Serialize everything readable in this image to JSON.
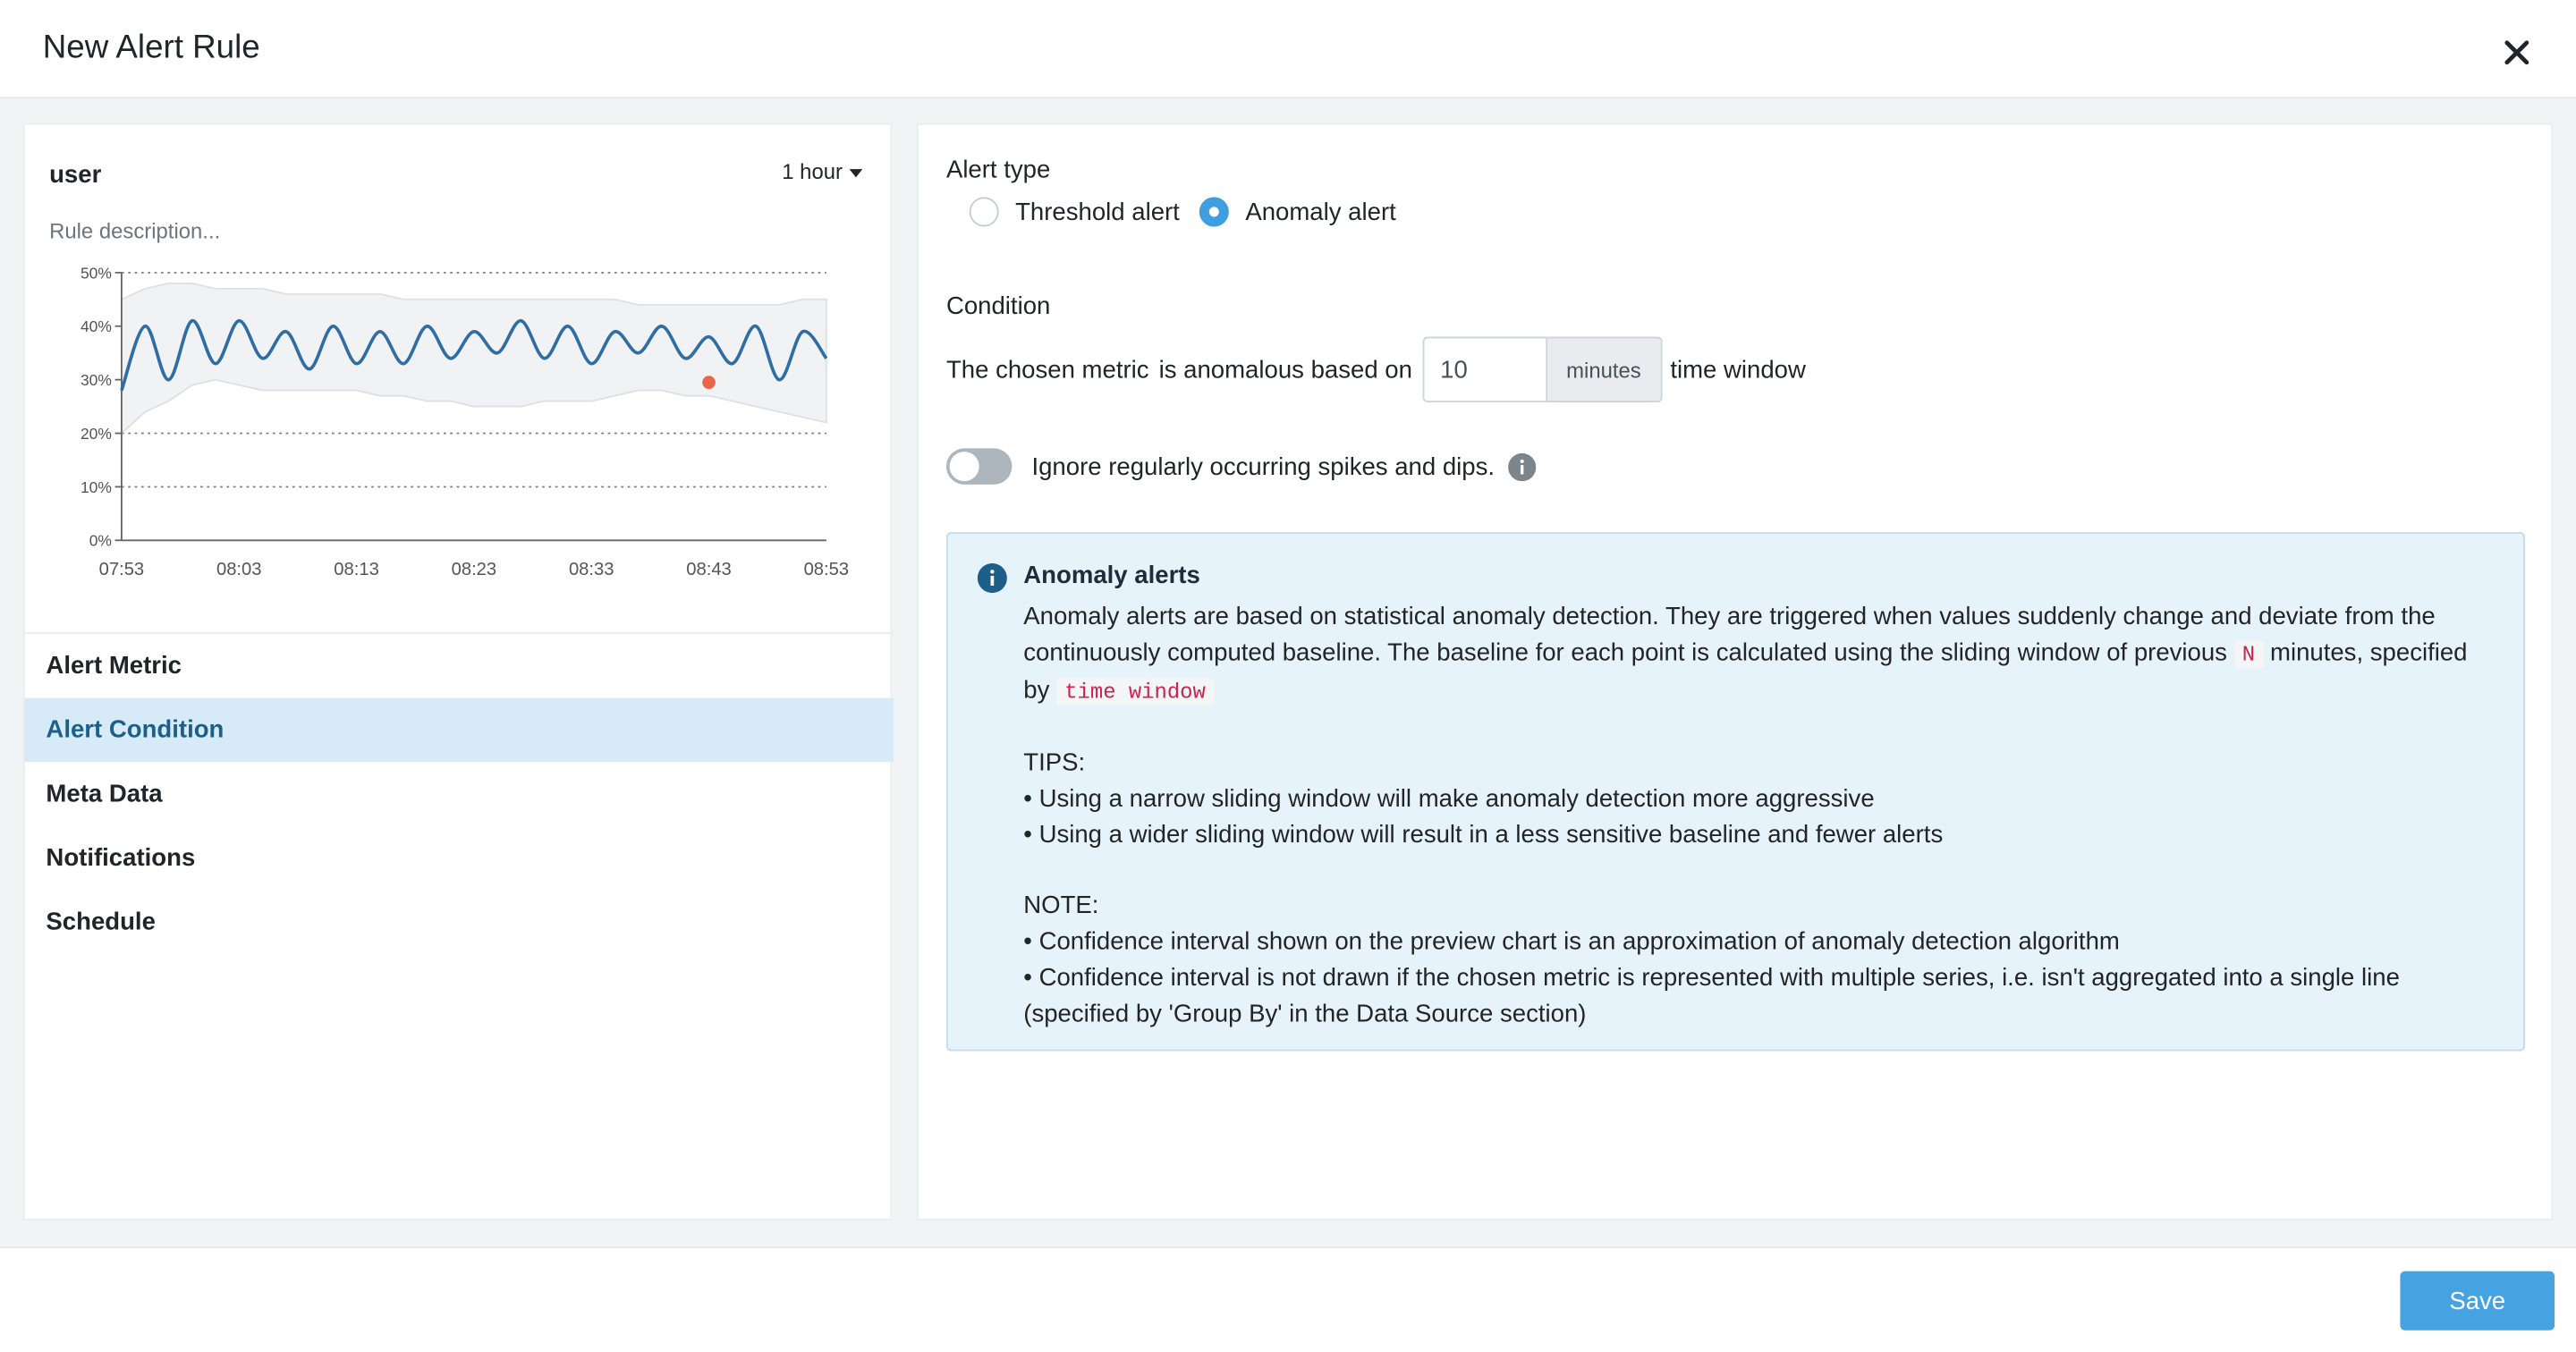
{
  "modal": {
    "title": "New Alert Rule"
  },
  "left": {
    "metric_name": "user",
    "range_label": "1 hour",
    "description_placeholder": "Rule description...",
    "nav": [
      {
        "label": "Alert Metric",
        "active": false
      },
      {
        "label": "Alert Condition",
        "active": true
      },
      {
        "label": "Meta Data",
        "active": false
      },
      {
        "label": "Notifications",
        "active": false
      },
      {
        "label": "Schedule",
        "active": false
      }
    ]
  },
  "chart_data": {
    "type": "line",
    "title": "",
    "xlabel": "",
    "ylabel": "",
    "ylim": [
      0,
      50
    ],
    "y_ticks": [
      "0%",
      "10%",
      "20%",
      "30%",
      "40%",
      "50%"
    ],
    "x_ticks": [
      "07:53",
      "08:03",
      "08:13",
      "08:23",
      "08:33",
      "08:43",
      "08:53"
    ],
    "grid": "horizontal-dotted",
    "x_minutes": [
      0,
      2,
      4,
      6,
      8,
      10,
      12,
      14,
      16,
      18,
      20,
      22,
      24,
      26,
      28,
      30,
      32,
      34,
      36,
      38,
      40,
      42,
      44,
      46,
      48,
      50,
      52,
      54,
      56,
      58,
      60
    ],
    "series": [
      {
        "values": [
          28,
          40,
          30,
          41,
          33,
          41,
          34,
          39,
          32,
          40,
          33,
          39,
          33,
          40,
          34,
          39,
          35,
          41,
          34,
          40,
          33,
          39,
          35,
          40,
          34,
          38,
          33,
          40,
          30,
          39,
          34
        ],
        "color": "#2f6ea5"
      }
    ],
    "band_upper": [
      45,
      47,
      48,
      48,
      47,
      47,
      47,
      46,
      46,
      46,
      46,
      46,
      45,
      45,
      45,
      45,
      45,
      45,
      45,
      45,
      45,
      45,
      44,
      44,
      44,
      44,
      44,
      44,
      44,
      45,
      45
    ],
    "band_lower": [
      20,
      24,
      26,
      29,
      30,
      29,
      28,
      28,
      28,
      28,
      28,
      27,
      27,
      26,
      26,
      25,
      25,
      25,
      26,
      26,
      26,
      27,
      28,
      28,
      27,
      27,
      26,
      25,
      24,
      23,
      22
    ],
    "anomaly_point": {
      "x": 50,
      "y": 29.5,
      "color": "#e8664a"
    }
  },
  "right": {
    "alert_type_label": "Alert type",
    "alert_types": [
      {
        "label": "Threshold alert",
        "selected": false
      },
      {
        "label": "Anomaly alert",
        "selected": true
      }
    ],
    "condition_label": "Condition",
    "condition": {
      "prefix": "The chosen metric",
      "middle": "is anomalous based on",
      "window_value": "10",
      "unit": "minutes",
      "suffix": "time window"
    },
    "ignore_spikes_label": "Ignore regularly occurring spikes and dips.",
    "ignore_spikes_on": false,
    "info": {
      "title": "Anomaly alerts",
      "p1_a": "Anomaly alerts are based on statistical anomaly detection. They are triggered when values suddenly change and deviate from the continuously computed baseline. The baseline for each point is calculated using the sliding window of previous ",
      "p1_code1": "N",
      "p1_b": " minutes, specified by ",
      "p1_code2": "time window",
      "tips_title": "TIPS:",
      "tip1": "• Using a narrow sliding window will make anomaly detection more aggressive",
      "tip2": "• Using a wider sliding window will result in a less sensitive baseline and fewer alerts",
      "note_title": "NOTE:",
      "note1": "• Confidence interval shown on the preview chart is an approximation of anomaly detection algorithm",
      "note2": "• Confidence interval is not drawn if the chosen metric is represented with multiple series, i.e. isn't aggregated into a single line (specified by 'Group By' in the Data Source section)"
    }
  },
  "footer": {
    "save_label": "Save"
  },
  "colors": {
    "accent": "#47a2e1",
    "active_nav_bg": "#d6ebf7",
    "info_bg": "#e6f3fb",
    "line": "#2f6ea5"
  }
}
